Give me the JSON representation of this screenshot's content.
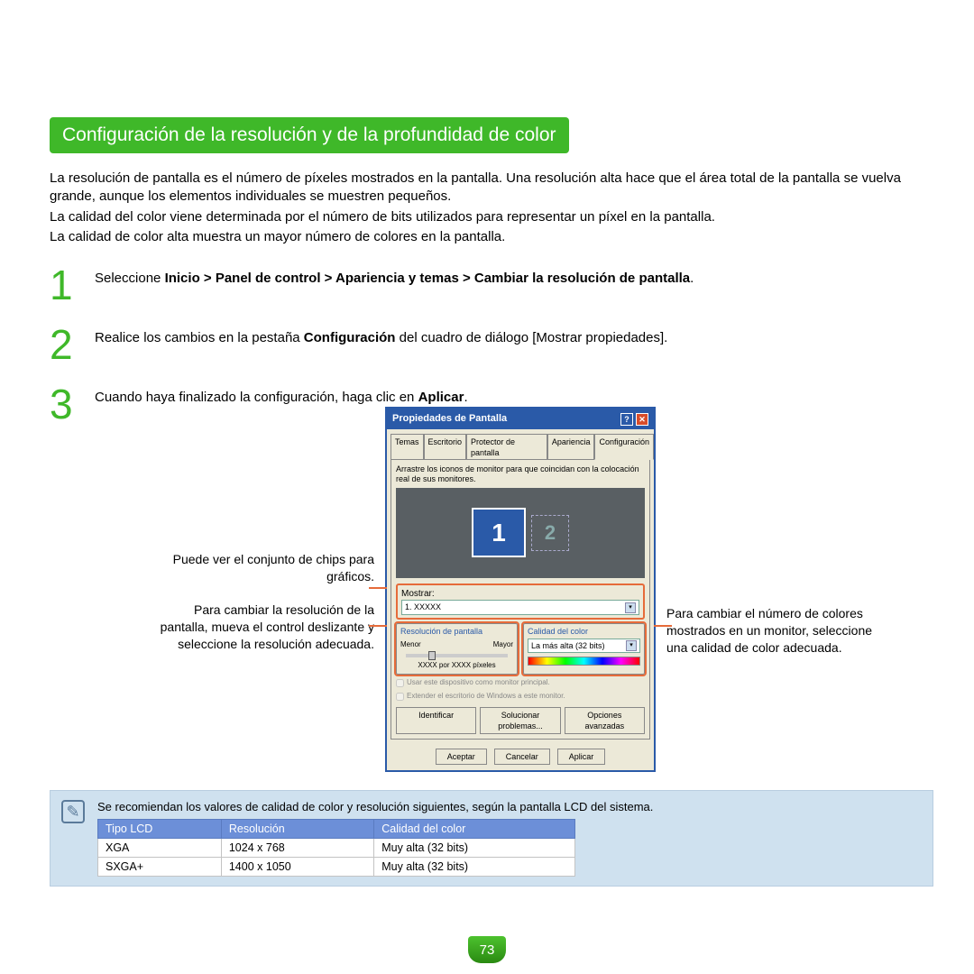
{
  "title": "Configuración de la resolución y de la profundidad de color",
  "intro": {
    "p1": "La resolución de pantalla es el número de píxeles mostrados en la pantalla. Una resolución alta hace que el área total de la pantalla se vuelva grande, aunque los elementos individuales se muestren pequeños.",
    "p2": "La calidad del color viene determinada por el número de bits utilizados para representar un píxel en la pantalla.",
    "p3": "La calidad de color alta muestra un mayor número de colores en la pantalla."
  },
  "steps": {
    "s1_pre": "Seleccione ",
    "s1_bold": "Inicio > Panel de control > Apariencia y temas > Cambiar la resolución de pantalla",
    "s1_post": ".",
    "s2_pre": "Realice los cambios en la pestaña ",
    "s2_bold": "Configuración",
    "s2_post": " del cuadro de diálogo [Mostrar propiedades].",
    "s3_pre": "Cuando haya finalizado la configuración, haga clic en ",
    "s3_bold": "Aplicar",
    "s3_post": "."
  },
  "callouts": {
    "left1": "Puede ver el conjunto de chips para gráficos.",
    "left2": "Para cambiar la resolución de la pantalla, mueva el control deslizante y seleccione la resolución adecuada.",
    "right1": "Para cambiar el número de colores mostrados en un monitor, seleccione una calidad de color adecuada."
  },
  "dialog": {
    "title": "Propiedades de Pantalla",
    "tabs": [
      "Temas",
      "Escritorio",
      "Protector de pantalla",
      "Apariencia",
      "Configuración"
    ],
    "instr": "Arrastre los iconos de monitor para que coincidan con la colocación real de sus monitores.",
    "mostrar_label": "Mostrar:",
    "mostrar_value": "1. XXXXX",
    "res_group": "Resolución de pantalla",
    "res_min": "Menor",
    "res_max": "Mayor",
    "res_pixels": "XXXX por XXXX píxeles",
    "color_group": "Calidad del color",
    "color_value": "La más alta (32 bits)",
    "chk1": "Usar este dispositivo como monitor principal.",
    "chk2": "Extender el escritorio de Windows a este monitor.",
    "btn_ident": "Identificar",
    "btn_trouble": "Solucionar problemas...",
    "btn_adv": "Opciones avanzadas",
    "btn_ok": "Aceptar",
    "btn_cancel": "Cancelar",
    "btn_apply": "Aplicar"
  },
  "note": {
    "text": "Se recomiendan los valores de calidad de color y resolución siguientes, según la pantalla LCD del sistema.",
    "headers": {
      "h1": "Tipo LCD",
      "h2": "Resolución",
      "h3": "Calidad del color"
    },
    "rows": [
      {
        "c1": "XGA",
        "c2": "1024 x 768",
        "c3": "Muy alta (32 bits)"
      },
      {
        "c1": "SXGA+",
        "c2": "1400 x 1050",
        "c3": "Muy alta (32 bits)"
      }
    ]
  },
  "page_number": "73"
}
